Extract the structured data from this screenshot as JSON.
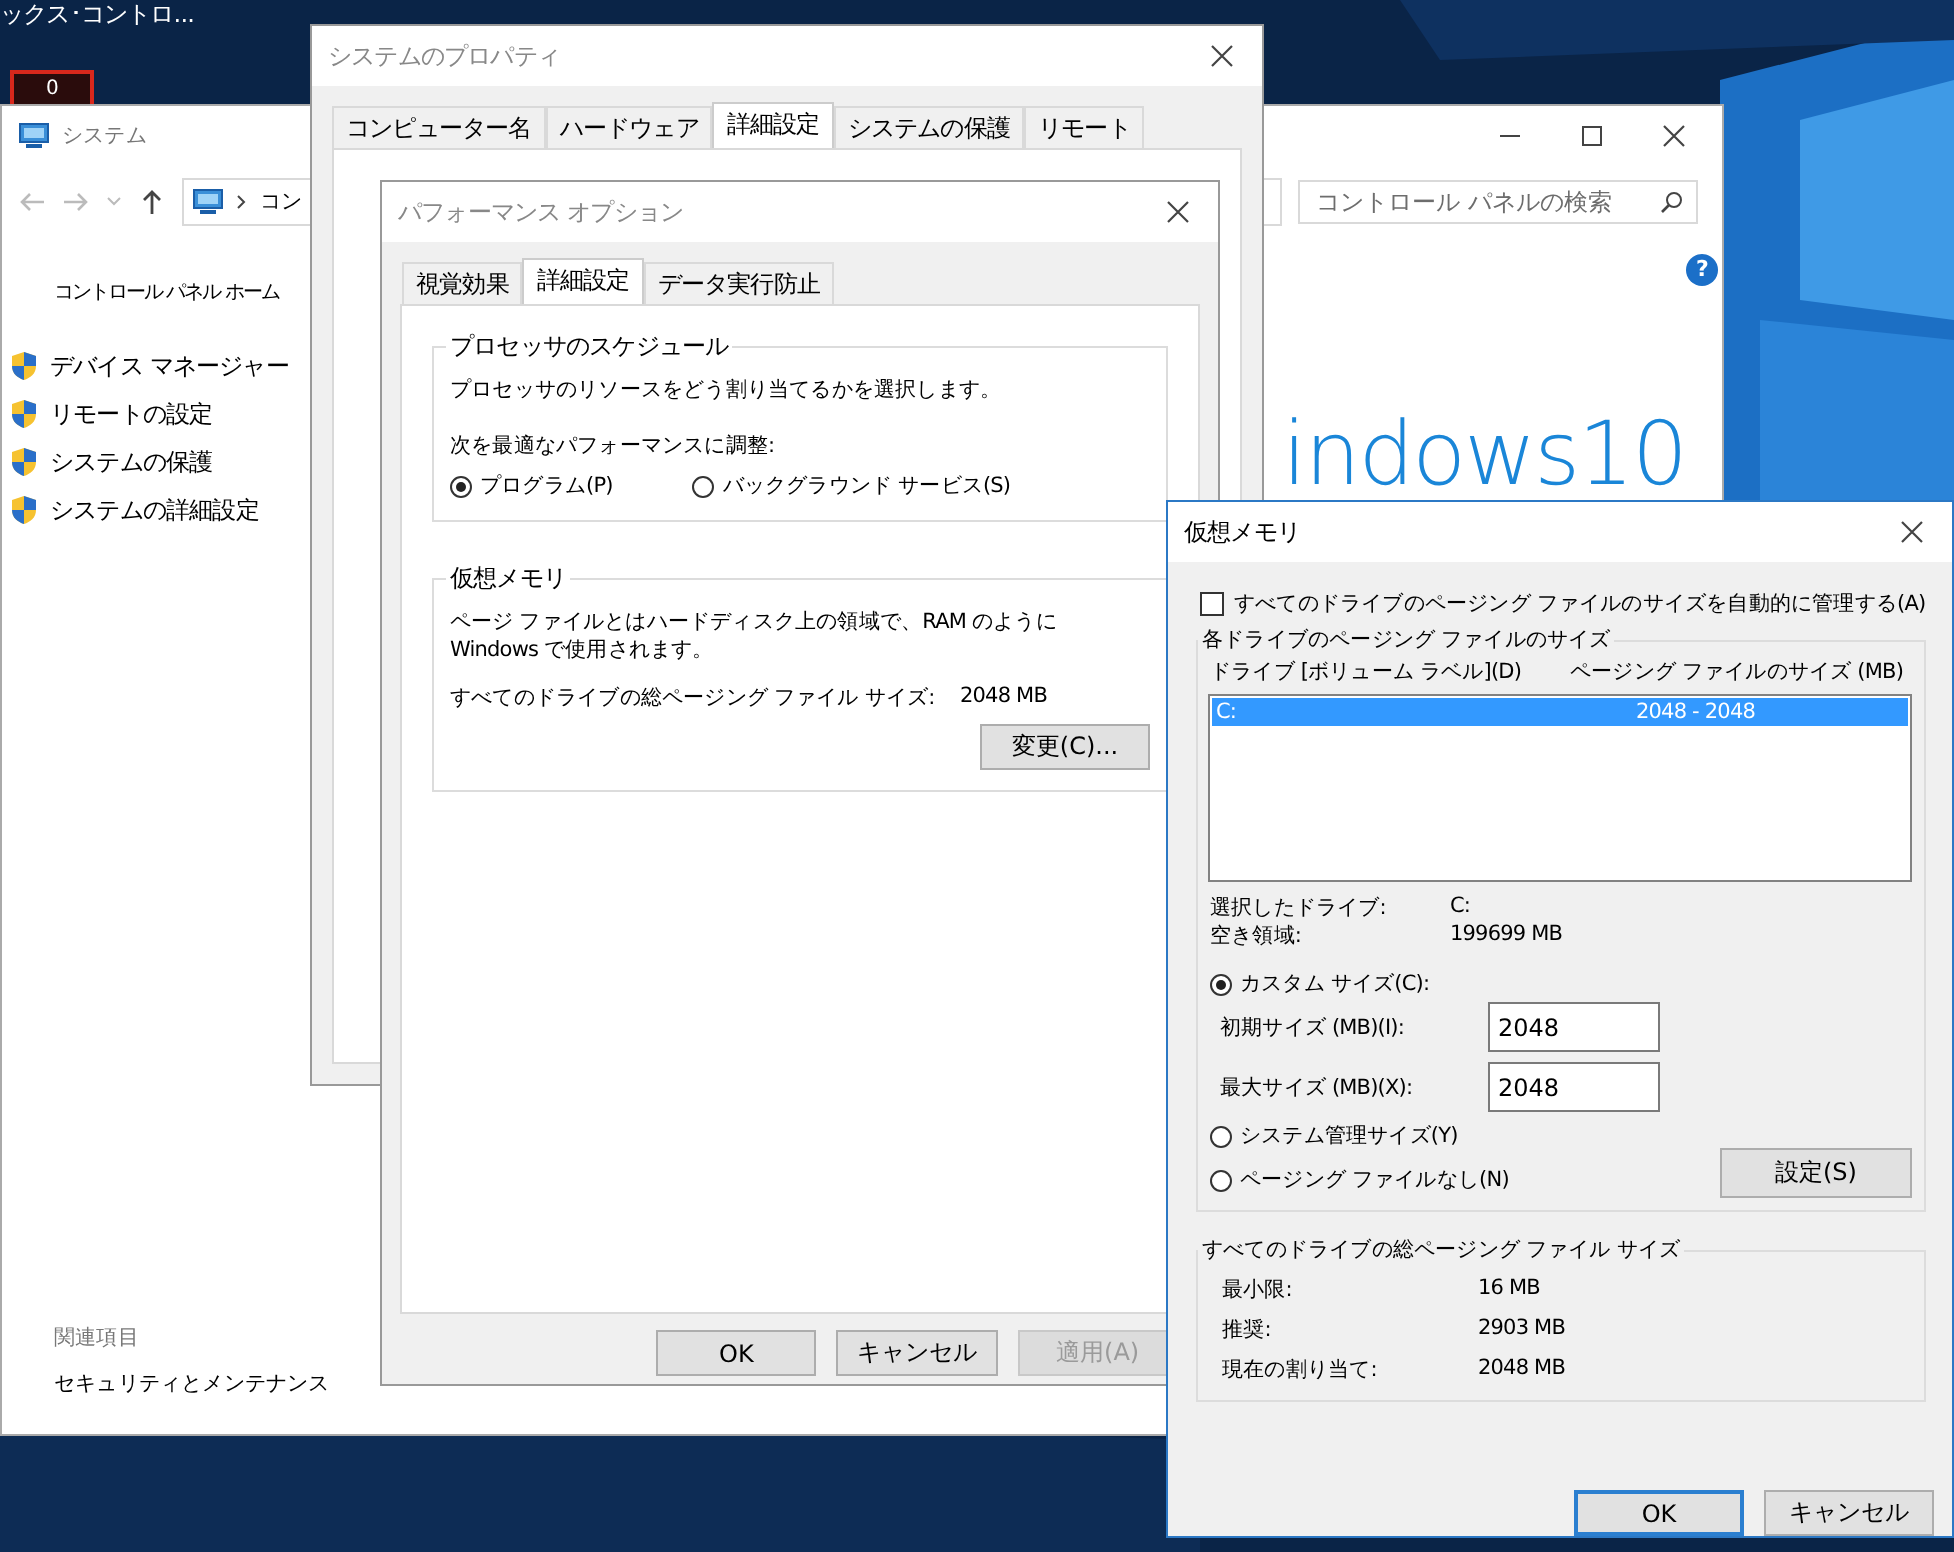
{
  "desktop": {
    "caption": "ックス･コントロ...",
    "badge": "0"
  },
  "system_window": {
    "title": "システム",
    "address": "コン",
    "search": {
      "placeholder": "コントロール パネルの検索"
    },
    "help": "?",
    "brand": "indows10",
    "sidebar": {
      "home": "コントロール パネル ホーム",
      "items": [
        "デバイス マネージャー",
        "リモートの設定",
        "システムの保護",
        "システムの詳細設定"
      ],
      "related_heading": "関連項目",
      "related_links": [
        "セキュリティとメンテナンス"
      ]
    }
  },
  "system_properties": {
    "title": "システムのプロパティ",
    "tabs": [
      {
        "label": "コンピューター名",
        "selected": false
      },
      {
        "label": "ハードウェア",
        "selected": false
      },
      {
        "label": "詳細設定",
        "selected": true
      },
      {
        "label": "システムの保護",
        "selected": false
      },
      {
        "label": "リモート",
        "selected": false
      }
    ]
  },
  "performance_options": {
    "title": "パフォーマンス オプション",
    "tabs": [
      {
        "label": "視覚効果",
        "selected": false
      },
      {
        "label": "詳細設定",
        "selected": true
      },
      {
        "label": "データ実行防止",
        "selected": false
      }
    ],
    "processor": {
      "heading": "プロセッサのスケジュール",
      "description": "プロセッサのリソースをどう割り当てるかを選択します。",
      "adjust_label": "次を最適なパフォーマンスに調整:",
      "options": [
        {
          "label": "プログラム(P)",
          "selected": true
        },
        {
          "label": "バックグラウンド サービス(S)",
          "selected": false
        }
      ]
    },
    "virtual_memory": {
      "heading": "仮想メモリ",
      "description": "ページ ファイルとはハードディスク上の領域で、RAM のように Windows で使用されます。",
      "total_label": "すべてのドライブの総ページング ファイル サイズ:",
      "total_value": "2048 MB",
      "change_button": "変更(C)..."
    },
    "buttons": [
      {
        "label": "OK",
        "disabled": false
      },
      {
        "label": "キャンセル",
        "disabled": false
      },
      {
        "label": "適用(A)",
        "disabled": true
      }
    ]
  },
  "virtual_memory_dialog": {
    "title": "仮想メモリ",
    "auto_manage": {
      "label": "すべてのドライブのページング ファイルのサイズを自動的に管理する(A)",
      "checked": false
    },
    "per_drive": {
      "heading": "各ドライブのページング ファイルのサイズ",
      "columns": [
        "ドライブ  [ボリューム ラベル](D)",
        "ページング ファイルのサイズ (MB)"
      ],
      "rows": [
        {
          "drive": "C:",
          "size": "2048 - 2048",
          "selected": true
        }
      ],
      "details": [
        {
          "label": "選択したドライブ:",
          "value": "C:"
        },
        {
          "label": "空き領域:",
          "value": "199699 MB"
        }
      ],
      "custom_option": {
        "label": "カスタム サイズ(C):",
        "selected": true
      },
      "fields": [
        {
          "label": "初期サイズ (MB)(I):",
          "value": "2048"
        },
        {
          "label": "最大サイズ (MB)(X):",
          "value": "2048"
        }
      ],
      "other_options": [
        {
          "label": "システム管理サイズ(Y)",
          "selected": false
        },
        {
          "label": "ページング ファイルなし(N)",
          "selected": false
        }
      ],
      "set_button": "設定(S)"
    },
    "totals": {
      "heading": "すべてのドライブの総ページング ファイル サイズ",
      "rows": [
        {
          "label": "最小限:",
          "value": "16 MB"
        },
        {
          "label": "推奨:",
          "value": "2903 MB"
        },
        {
          "label": "現在の割り当て:",
          "value": "2048 MB"
        }
      ]
    },
    "buttons": [
      {
        "label": "OK",
        "default": true
      },
      {
        "label": "キャンセル",
        "default": false
      }
    ]
  }
}
